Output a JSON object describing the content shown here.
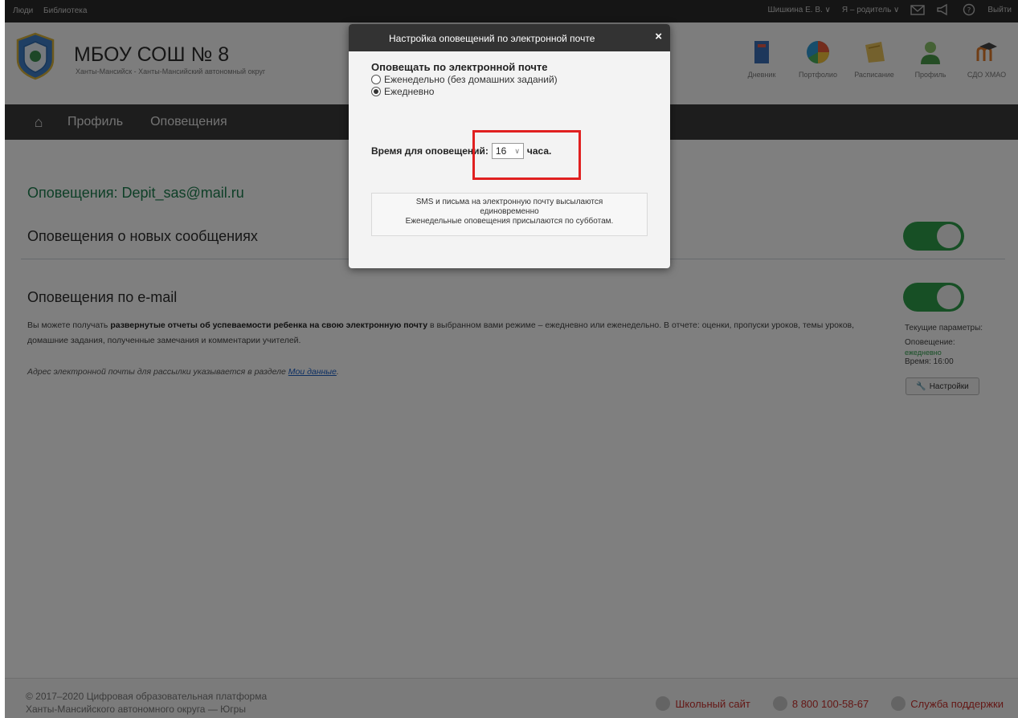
{
  "topbar": {
    "left": [
      "Люди",
      "Библиотека"
    ],
    "user": "Шишкина Е. В. ∨",
    "role": "Я – родитель ∨",
    "logout": "Выйти"
  },
  "header": {
    "school_name": "МБОУ СОШ № 8",
    "school_sub": "Ханты-Мансийск - Ханты-Мансийский автономный округ",
    "apps": [
      {
        "label": "Дневник",
        "icon": "diary-icon"
      },
      {
        "label": "Портфолио",
        "icon": "portfolio-icon"
      },
      {
        "label": "Расписание",
        "icon": "schedule-icon"
      },
      {
        "label": "Профиль",
        "icon": "profile-icon"
      },
      {
        "label": "СДО ХМАО",
        "icon": "moodle-icon"
      }
    ]
  },
  "nav": {
    "items": [
      "Профиль",
      "Оповещения"
    ]
  },
  "main": {
    "title": "Оповещения: Depit_sas@mail.ru",
    "section1": "Оповещения о новых сообщениях",
    "section2": "Оповещения по e-mail",
    "desc_pre": "Вы можете получать ",
    "desc_bold": "развернутые отчеты об успеваемости ребенка на свою электронную почту",
    "desc_post": " в выбранном вами режиме – ежедневно или еженедельно. В отчете: оценки, пропуски уроков, темы уроков, домашние задания, полученные замечания и комментарии учителей.",
    "addr_pre": "Адрес электронной почты для рассылки указывается в разделе ",
    "addr_link": "Мои данные",
    "addr_post": ".",
    "params_title": "Текущие параметры:",
    "params_notify": "Оповещение:",
    "params_mode": "ежедневно",
    "params_time": "Время: 16:00",
    "settings_label": "Настройки"
  },
  "footer": {
    "copy1": "© 2017–2020 Цифровая образовательная платформа",
    "copy2": "Ханты-Мансийского автономного округа — Югры",
    "school_site": "Школьный сайт",
    "phone": "8 800 100-58-67",
    "support": "Служба поддержки"
  },
  "modal": {
    "title": "Настройка оповещений по электронной почте",
    "close": "×",
    "label": "Оповещать по электронной почте",
    "option_weekly": "Еженедельно (без домашних заданий)",
    "option_daily": "Ежедневно",
    "time_label": "Время для оповещений:",
    "time_value": "16",
    "time_unit": "часа.",
    "info_line1": "SMS и письма на электронную почту высылаются",
    "info_line2": "единовременно",
    "info_line3": "Еженедельные оповещения присылаются по субботам."
  },
  "colors": {
    "accent_green": "#2e9e4a",
    "highlight_red": "#e02020",
    "link_blue": "#1a5ec4"
  }
}
